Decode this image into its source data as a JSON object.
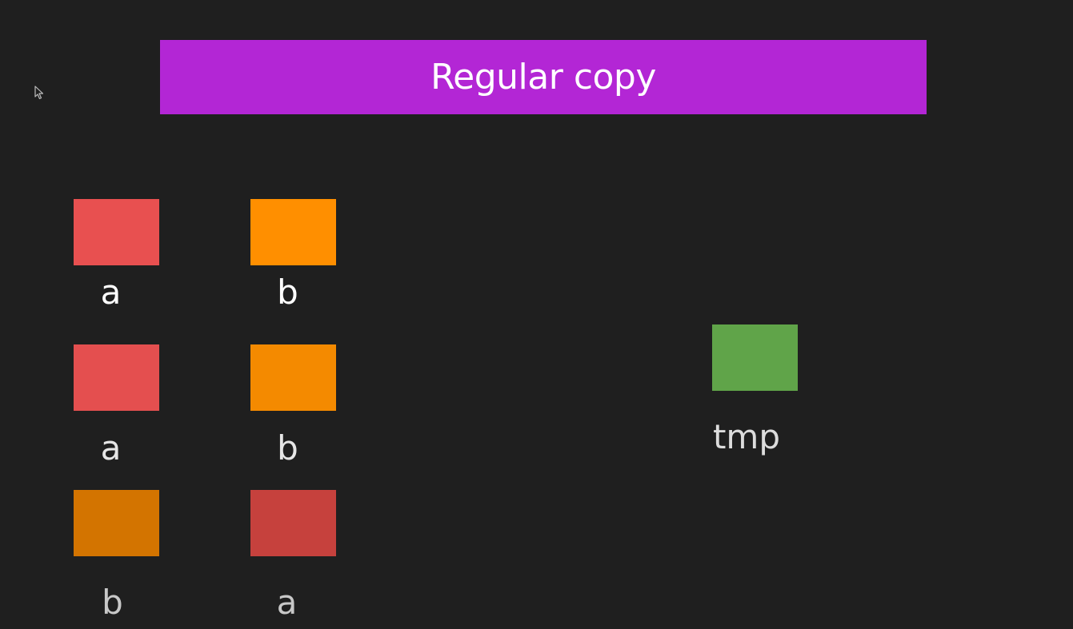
{
  "title": "Regular copy",
  "colors": {
    "background": "#1f1f1f",
    "banner": "#b326d5",
    "red_bright": "#e85050",
    "orange_bright": "#ff8f00",
    "red_mid": "#e44f4f",
    "orange_mid": "#f48a00",
    "orange_dim": "#d37400",
    "red_dim": "#c6413d",
    "green": "#60a449"
  },
  "rows": [
    {
      "left": {
        "label": "a",
        "color": "#e85050"
      },
      "right": {
        "label": "b",
        "color": "#ff8f00"
      }
    },
    {
      "left": {
        "label": "a",
        "color": "#e44f4f"
      },
      "right": {
        "label": "b",
        "color": "#f48a00"
      }
    },
    {
      "left": {
        "label": "b",
        "color": "#d37400"
      },
      "right": {
        "label": "a",
        "color": "#c6413d"
      }
    }
  ],
  "tmp": {
    "label": "tmp",
    "color": "#60a449"
  }
}
